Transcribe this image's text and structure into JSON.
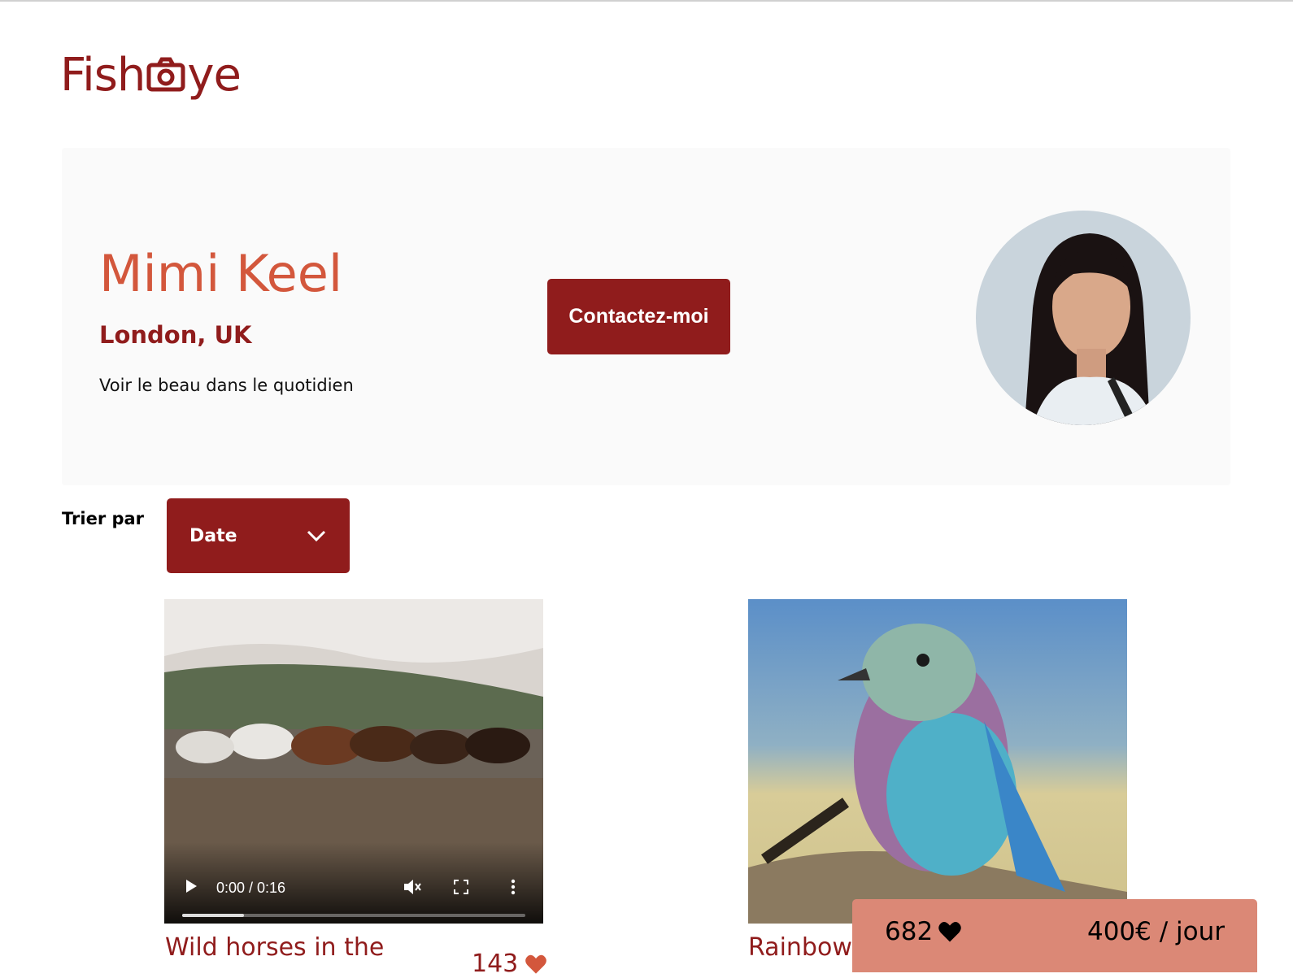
{
  "logo": {
    "prefix": "Fish",
    "suffix": "ye",
    "camera_icon": "camera-icon"
  },
  "photographer": {
    "name": "Mimi Keel",
    "location": "London, UK",
    "tagline": "Voir le beau dans le quotidien",
    "contact_label": "Contactez-moi"
  },
  "sort": {
    "label": "Trier par",
    "selected": "Date"
  },
  "media": [
    {
      "title": "Wild horses in the",
      "likes": "143",
      "video_time": "0:00 / 0:16",
      "progress": 0.18
    },
    {
      "title": "Rainbow"
    }
  ],
  "summary": {
    "total_likes": "682",
    "price": "400€ / jour"
  },
  "colors": {
    "primary": "#901C1C",
    "secondary": "#D3573C",
    "sticky": "#DB8876",
    "header_bg": "#FAFAFA"
  }
}
